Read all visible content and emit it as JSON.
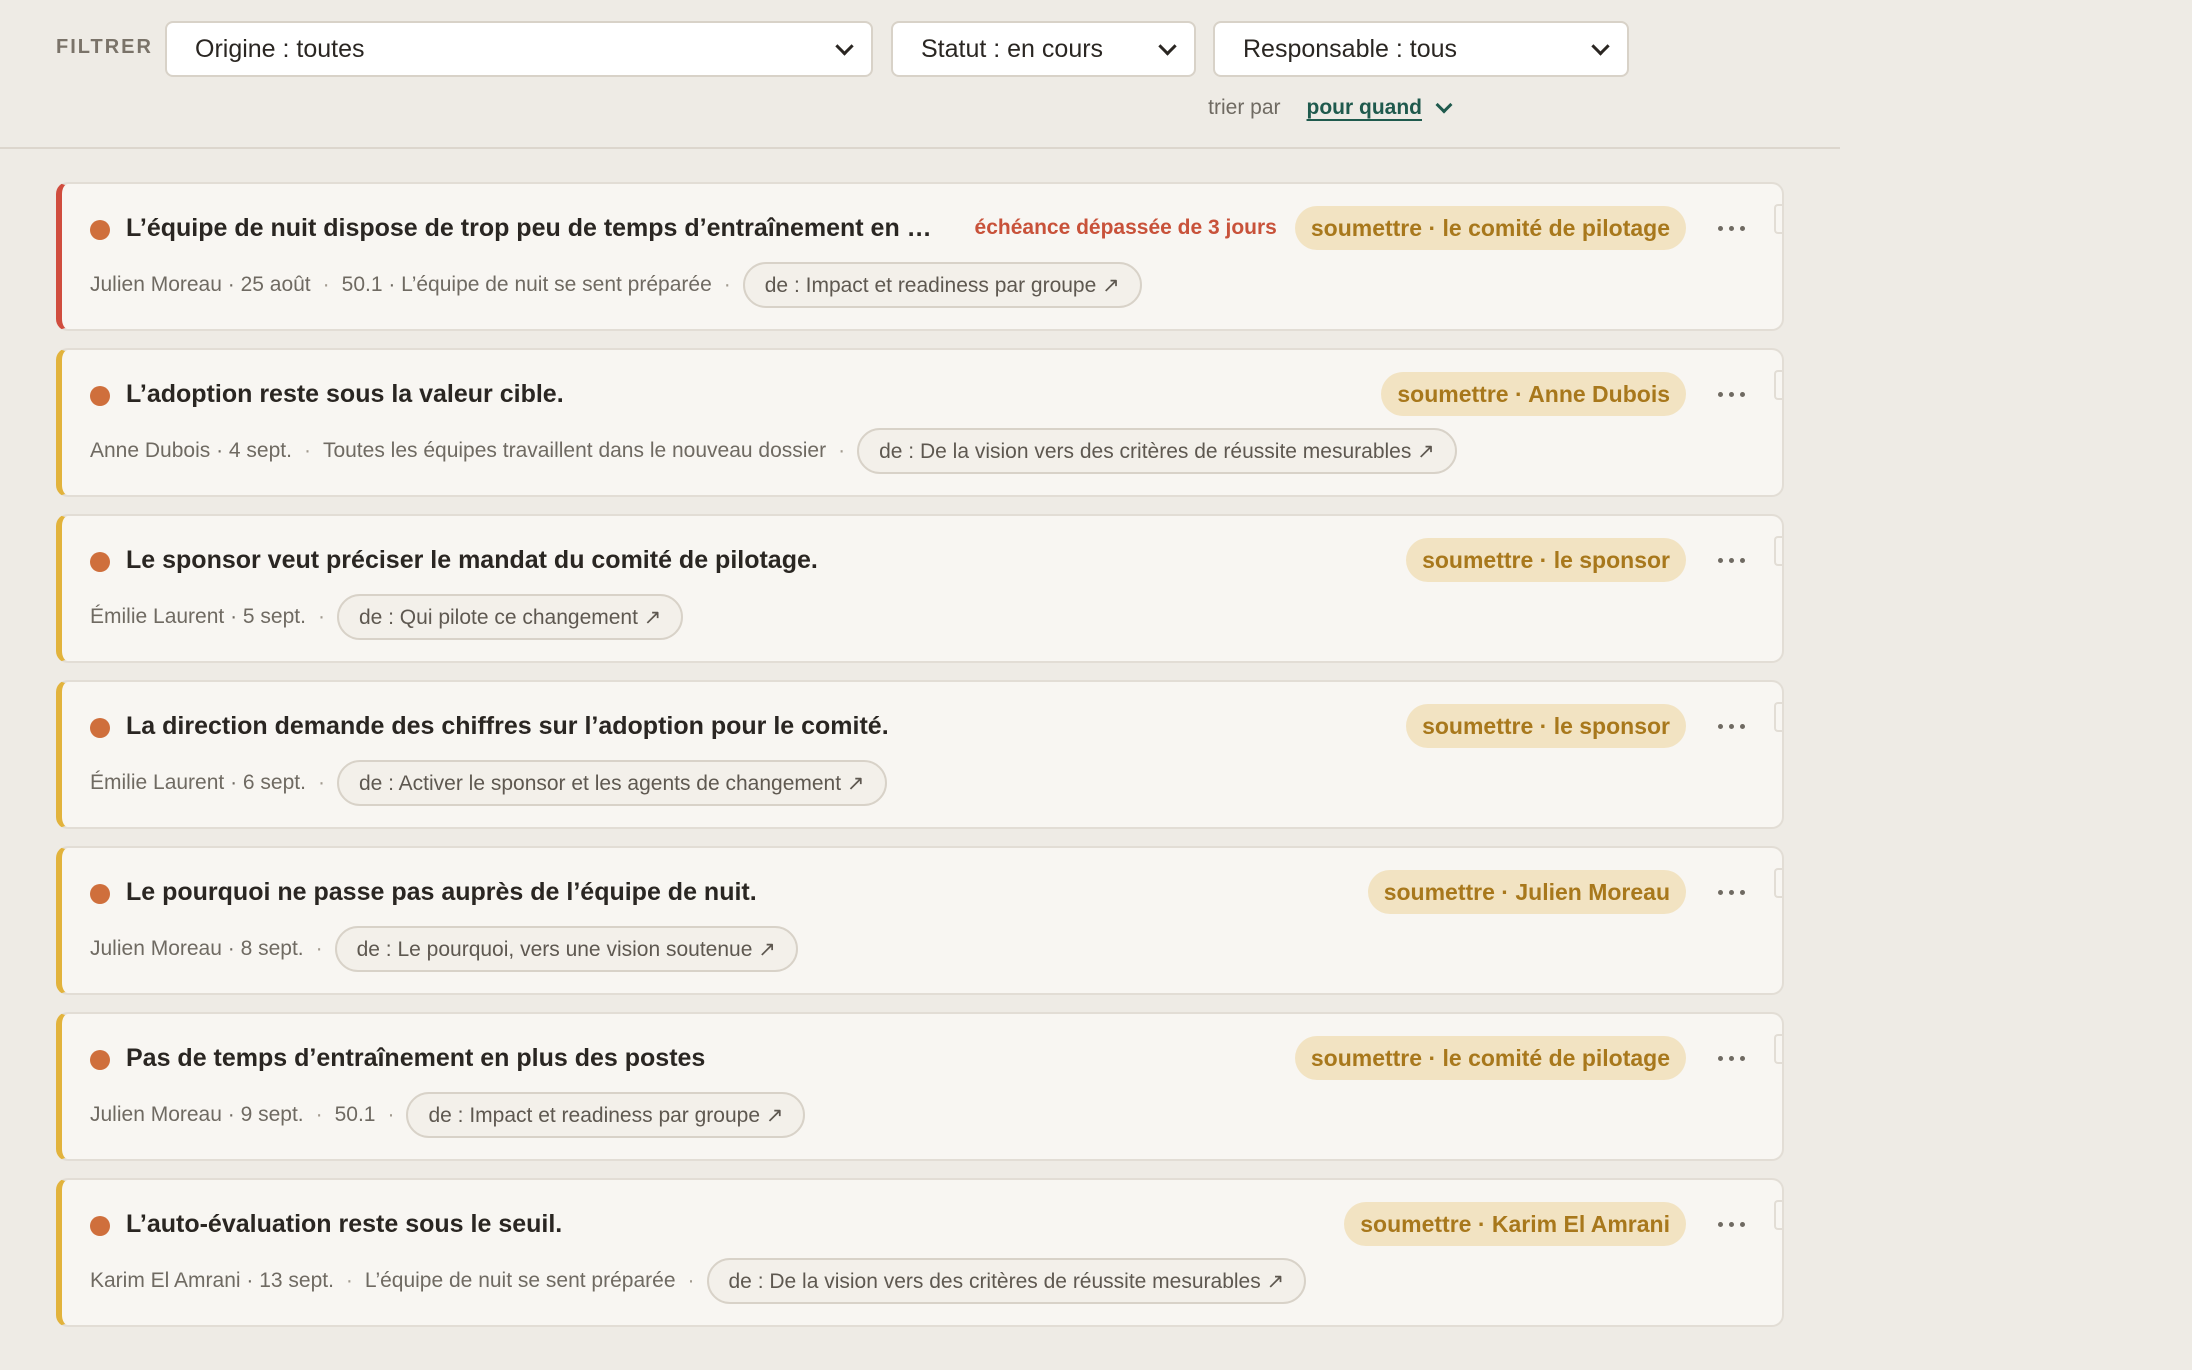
{
  "filterbar": {
    "label": "FILTRER",
    "origin": "Origine : toutes",
    "status": "Statut : en cours",
    "owner": "Responsable : tous",
    "sort_label": "trier par",
    "sort_value": "pour quand"
  },
  "items": [
    {
      "title": "L’équipe de nuit dispose de trop peu de temps d’entraînement en plus des postes",
      "overdue": "échéance dépassée de 3 jours",
      "action": "soumettre · le comité de pilotage",
      "author_date": "Julien Moreau · 25 août",
      "context": "50.1 · L’équipe de nuit se sent préparée",
      "origin": "de : Impact et readiness par groupe ↗"
    },
    {
      "title": "L’adoption reste sous la valeur cible.",
      "action": "soumettre · Anne Dubois",
      "author_date": "Anne Dubois · 4 sept.",
      "context": "Toutes les équipes travaillent dans le nouveau dossier",
      "origin": "de : De la vision vers des critères de réussite mesurables ↗"
    },
    {
      "title": "Le sponsor veut préciser le mandat du comité de pilotage.",
      "action": "soumettre · le sponsor",
      "author_date": "Émilie Laurent · 5 sept.",
      "origin": "de : Qui pilote ce changement ↗"
    },
    {
      "title": "La direction demande des chiffres sur l’adoption pour le comité.",
      "action": "soumettre · le sponsor",
      "author_date": "Émilie Laurent · 6 sept.",
      "origin": "de : Activer le sponsor et les agents de changement ↗"
    },
    {
      "title": "Le pourquoi ne passe pas auprès de l’équipe de nuit.",
      "action": "soumettre · Julien Moreau",
      "author_date": "Julien Moreau · 8 sept.",
      "origin": "de : Le pourquoi, vers une vision soutenue ↗"
    },
    {
      "title": "Pas de temps d’entraînement en plus des postes",
      "action": "soumettre · le comité de pilotage",
      "author_date": "Julien Moreau · 9 sept.",
      "context": "50.1",
      "origin": "de : Impact et readiness par groupe ↗"
    },
    {
      "title": "L’auto-évaluation reste sous le seuil.",
      "action": "soumettre · Karim El Amrani",
      "author_date": "Karim El Amrani · 13 sept.",
      "context": "L’équipe de nuit se sent préparée",
      "origin": "de : De la vision vers des critères de réussite mesurables ↗"
    }
  ],
  "colors": {
    "background": "#eeebe5",
    "card": "#f8f6f2",
    "accent_pending": "#e2b33c",
    "accent_overdue": "#d04d3e",
    "status_dot": "#cf6f3c",
    "action_chip_bg": "#f2e3c2",
    "action_chip_text": "#a8781c",
    "sort_link": "#1f5a4d"
  }
}
